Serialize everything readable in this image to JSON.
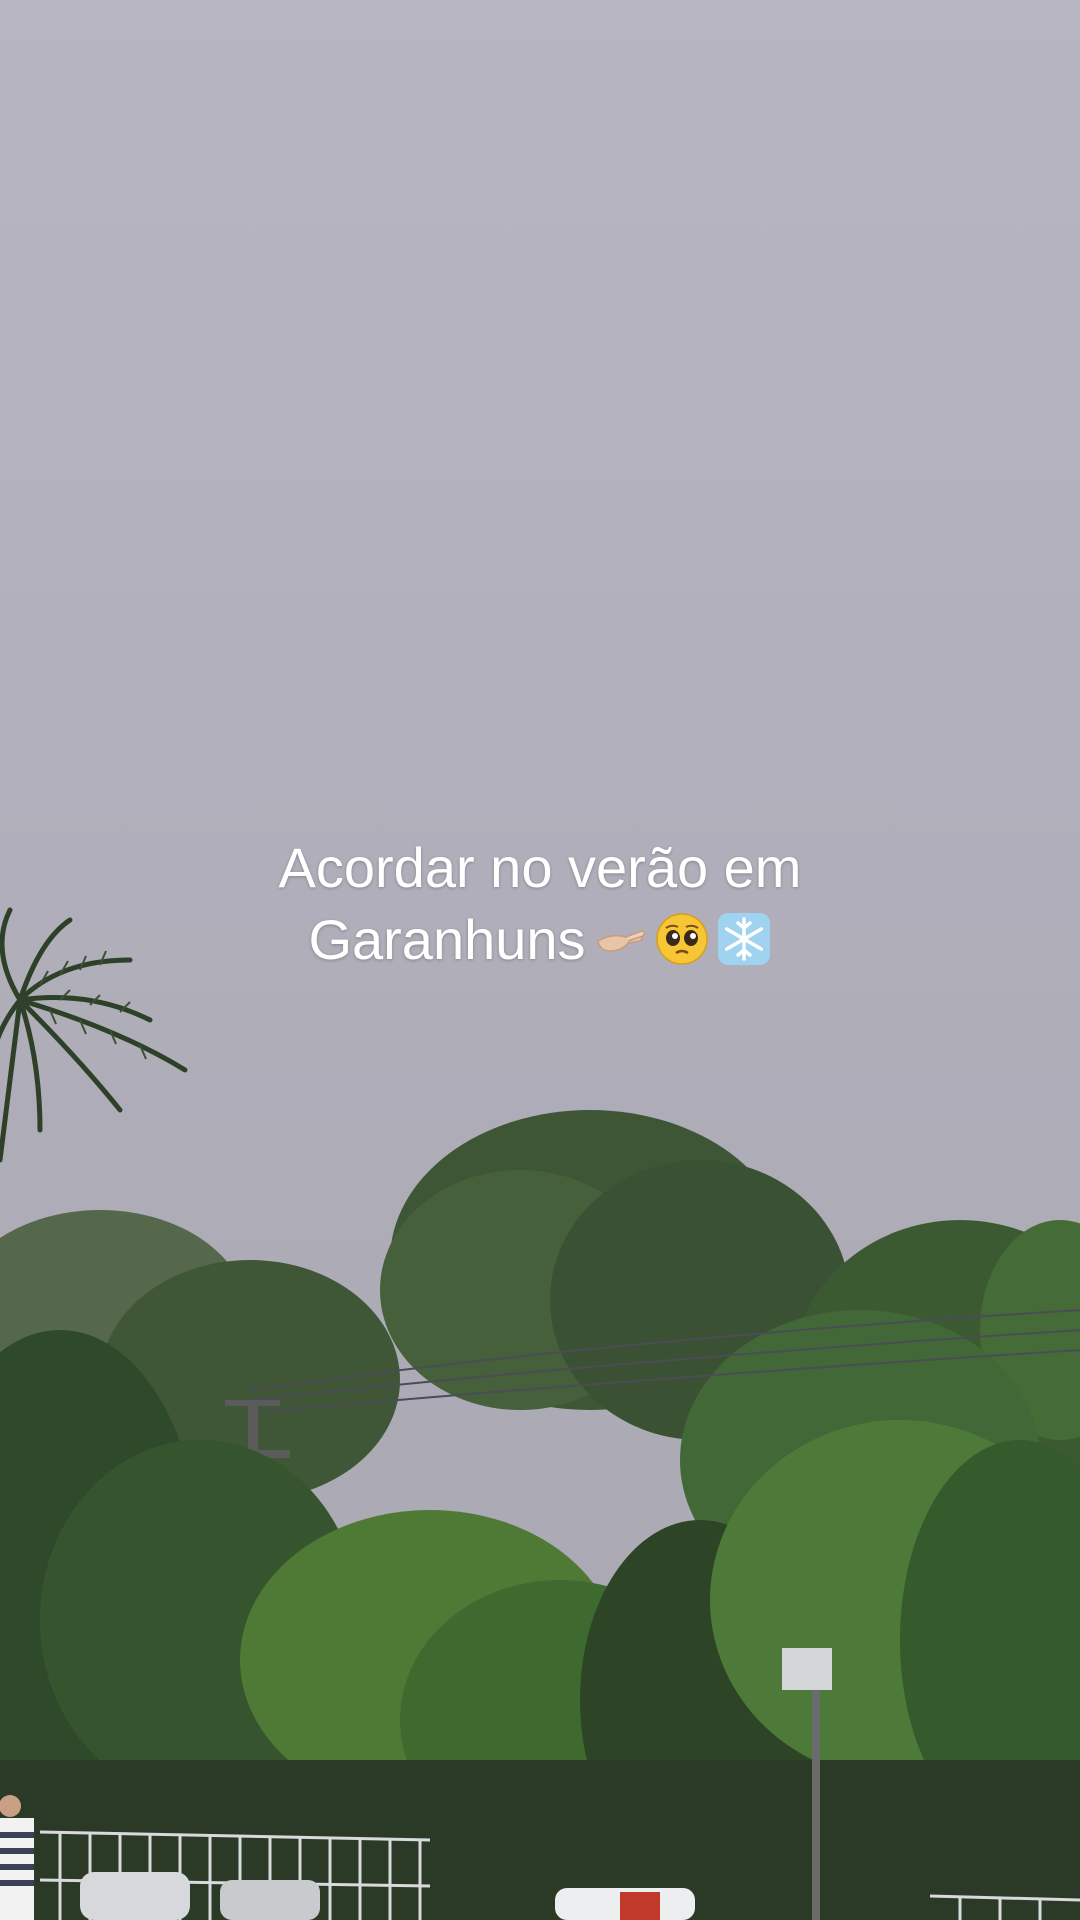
{
  "caption": {
    "line1": "Acordar no verão em",
    "line2": "Garanhuns"
  },
  "emojis": [
    "pinching-hand-icon",
    "pleading-face-icon",
    "snowflake-icon"
  ],
  "colors": {
    "sky": "#b2b0bc",
    "foliage_dark": "#2f4a2a",
    "foliage_light": "#4f7a36",
    "caption_text": "#ffffff"
  }
}
